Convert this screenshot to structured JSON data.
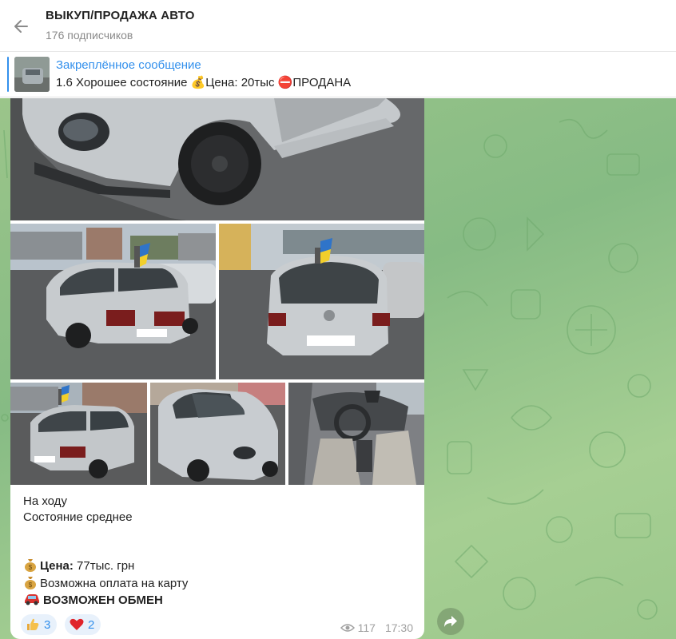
{
  "header": {
    "title": "ВЫКУП/ПРОДАЖА АВТО",
    "subscribers": "176 подписчиков"
  },
  "pinned": {
    "title": "Закреплённое сообщение",
    "text": "1.6  Хорошее состояние  💰Цена: 20тыс ⛔ПРОДАНА"
  },
  "message": {
    "caption_line1": "На ходу",
    "caption_line2": "Состояние среднее",
    "price_label": "Цена:",
    "price_value": " 77тыс. грн",
    "card_payment": "Возможна оплата на карту",
    "exchange": "ВОЗМОЖЕН ОБМЕН",
    "reactions": [
      {
        "emoji": "👍",
        "count": "3"
      },
      {
        "emoji": "❤️",
        "count": "2"
      }
    ],
    "views": "117",
    "time": "17:30"
  },
  "colors": {
    "accent": "#3390ec",
    "chat_bg": "#8fc287",
    "bubble": "#ffffff"
  },
  "icons": [
    "back-arrow-icon",
    "money-bag-icon",
    "no-entry-icon",
    "car-icon",
    "thumbs-up-icon",
    "heart-icon",
    "eye-icon",
    "forward-icon"
  ]
}
